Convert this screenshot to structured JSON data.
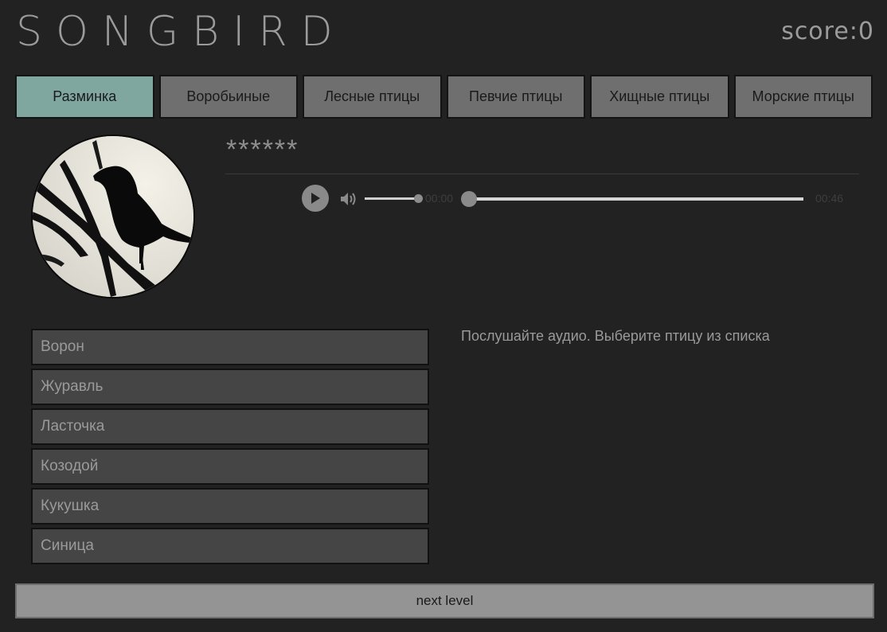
{
  "header": {
    "logo": "SONGBIRD",
    "score": "score:0"
  },
  "tabs": [
    {
      "label": "Разминка",
      "active": true
    },
    {
      "label": "Воробьиные",
      "active": false
    },
    {
      "label": "Лесные птицы",
      "active": false
    },
    {
      "label": "Певчие птицы",
      "active": false
    },
    {
      "label": "Хищные птицы",
      "active": false
    },
    {
      "label": "Морские птицы",
      "active": false
    }
  ],
  "question": {
    "hidden_name": "******",
    "image_icon": "bird-silhouette-icon"
  },
  "player": {
    "current_time": "00:00",
    "total_time": "00:46",
    "volume_level": 0.75,
    "progress": 0
  },
  "answers": [
    {
      "label": "Ворон"
    },
    {
      "label": "Журавль"
    },
    {
      "label": "Ласточка"
    },
    {
      "label": "Козодой"
    },
    {
      "label": "Кукушка"
    },
    {
      "label": "Синица"
    }
  ],
  "info": {
    "hint": "Послушайте аудио. Выберите птицу из списка"
  },
  "footer": {
    "next_label": "next level"
  },
  "colors": {
    "background": "#222222",
    "active_tab": "#7fa7a0",
    "tab": "#6f6f6f",
    "answer": "#454545",
    "next_button": "#949494"
  }
}
